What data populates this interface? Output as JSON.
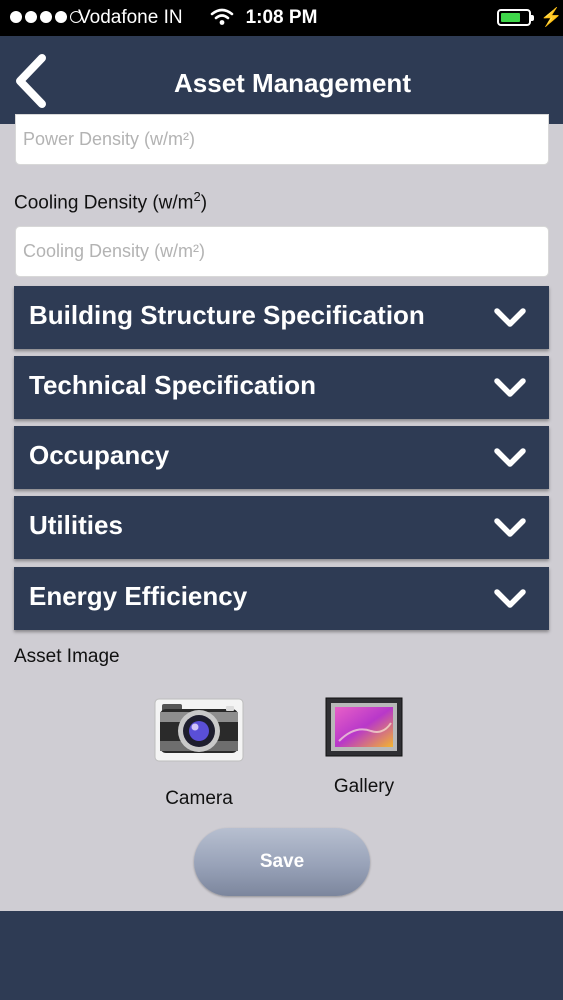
{
  "status_bar": {
    "carrier": "Vodafone IN",
    "time": "1:08 PM",
    "signal_bars_filled": 4,
    "signal_bars_total": 5,
    "battery_level": 0.6,
    "icons": [
      "signal-icon",
      "wifi-icon",
      "battery-icon",
      "charging-bolt-icon"
    ]
  },
  "nav": {
    "title": "Asset Management",
    "back_icon": "chevron-left-icon"
  },
  "form": {
    "power_density_placeholder": "Power Density (w/m²)",
    "power_density_value": "",
    "cooling_density_label_prefix": "Cooling Density (w/m",
    "cooling_density_label_sup": "2",
    "cooling_density_label_suffix": ")",
    "cooling_density_placeholder": "Cooling Density (w/m²)",
    "cooling_density_value": ""
  },
  "sections": [
    {
      "label": "Building Structure Specification"
    },
    {
      "label": "Technical Specification"
    },
    {
      "label": "Occupancy"
    },
    {
      "label": "Utilities"
    },
    {
      "label": "Energy Efficiency"
    }
  ],
  "asset_image": {
    "label": "Asset Image",
    "camera_label": "Camera",
    "gallery_label": "Gallery"
  },
  "save_label": "Save",
  "colors": {
    "nav_bg": "#2e3b54",
    "page_bg": "#cfcdd3",
    "battery": "#3fd64a"
  }
}
